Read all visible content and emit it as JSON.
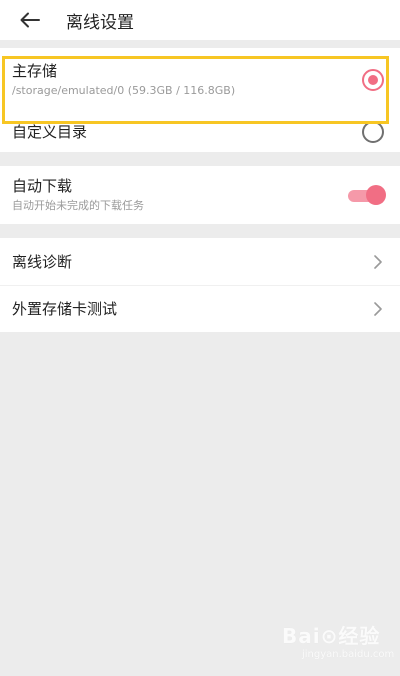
{
  "header": {
    "title": "离线设置",
    "back_icon": "arrow-left-icon"
  },
  "storage": {
    "main": {
      "label": "主存储",
      "path": "/storage/emulated/0 (59.3GB / 116.8GB)",
      "selected": true
    },
    "custom": {
      "label": "自定义目录",
      "selected": false
    }
  },
  "auto_download": {
    "label": "自动下载",
    "description": "自动开始未完成的下载任务",
    "enabled": true
  },
  "menu": {
    "items": [
      {
        "label": "离线诊断"
      },
      {
        "label": "外置存储卡测试"
      }
    ]
  },
  "colors": {
    "accent": "#f16e84",
    "highlight": "#f7c623",
    "background": "#ececec"
  },
  "watermark": {
    "text": "Bai⊙经验",
    "sub": "jingyan.baidu.com"
  }
}
